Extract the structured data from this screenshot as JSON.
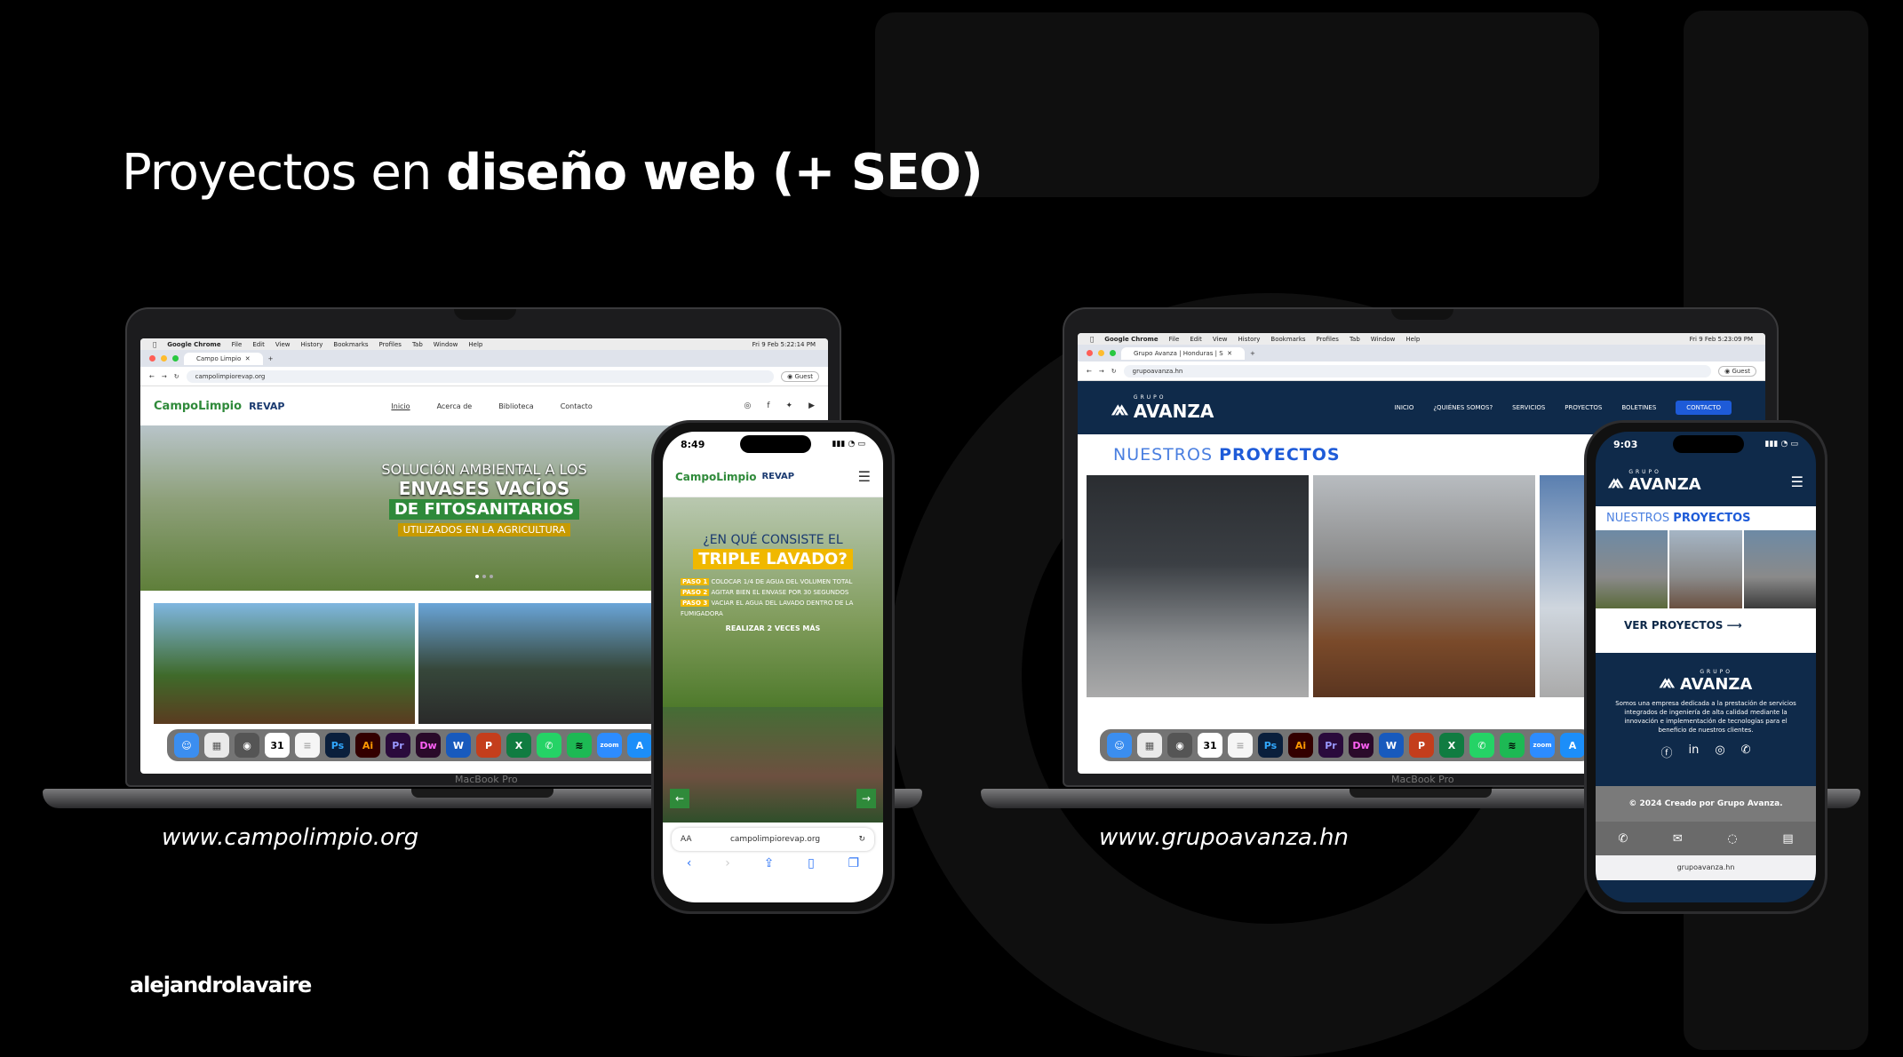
{
  "title": {
    "prefix": "Proyectos en ",
    "bold": "diseño web (+ SEO)"
  },
  "brand": "alejandrolavaire",
  "projects": [
    {
      "url_label": "www.campolimpio.org",
      "laptop_label": "MacBook Pro",
      "menubar": {
        "app": "Google Chrome",
        "menus": [
          "File",
          "Edit",
          "View",
          "History",
          "Bookmarks",
          "Profiles",
          "Tab",
          "Window",
          "Help"
        ],
        "clock": "Fri 9 Feb  5:22:14 PM"
      },
      "tab_title": "Campo Limpio",
      "address": "campolimpiorevap.org",
      "guest": "Guest",
      "logo": "CampoLimpio",
      "logo2": "REVAP",
      "nav": [
        "Inicio",
        "Acerca de",
        "Biblioteca",
        "Contacto"
      ],
      "hero": {
        "line1": "SOLUCIÓN AMBIENTAL A LOS",
        "line2": "ENVASES VACÍOS",
        "line3": "DE FITOSANITARIOS",
        "line4": "UTILIZADOS EN LA AGRICULTURA"
      },
      "phone": {
        "time": "8:49",
        "heading1": "¿EN QUÉ CONSISTE EL",
        "heading2": "TRIPLE LAVADO?",
        "steps": [
          {
            "tag": "PASO 1",
            "text": "COLOCAR 1/4 DE AGUA DEL VOLUMEN TOTAL"
          },
          {
            "tag": "PASO 2",
            "text": "AGITAR BIEN EL ENVASE  POR 30 SEGUNDOS"
          },
          {
            "tag": "PASO 3",
            "text": "VACIAR EL AGUA DEL LAVADO DENTRO DE LA FUMIGADORA"
          }
        ],
        "cta": "REALIZAR 2 VECES MÁS",
        "address_aa": "AA",
        "address": "campolimpiorevap.org"
      }
    },
    {
      "url_label": "www.grupoavanza.hn",
      "laptop_label": "MacBook Pro",
      "menubar": {
        "app": "Google Chrome",
        "menus": [
          "File",
          "Edit",
          "View",
          "History",
          "Bookmarks",
          "Profiles",
          "Tab",
          "Window",
          "Help"
        ],
        "clock": "Fri 9 Feb  5:23:09 PM"
      },
      "tab_title": "Grupo Avanza | Honduras | S",
      "address": "grupoavanza.hn",
      "guest": "Guest",
      "logo_small": "GRUPO",
      "logo": "AVANZA",
      "nav": [
        "INICIO",
        "¿QUIÉNES SOMOS?",
        "SERVICIOS",
        "PROYECTOS",
        "BOLETINES",
        "CONTACTO"
      ],
      "section_title_a": "NUESTROS ",
      "section_title_b": "PROYECTOS",
      "phone": {
        "time": "9:03",
        "section_title_a": "NUESTROS ",
        "section_title_b": "PROYECTOS",
        "cta": "VER PROYECTOS",
        "logo_small": "GRUPO",
        "logo": "AVANZA",
        "description": "Somos una empresa dedicada a la prestación de servicios integrados de ingeniería de alta calidad mediante la innovación e implementación de tecnologías para el beneficio de nuestros clientes.",
        "copyright": "© 2024 Creado por Grupo Avanza.",
        "address": "grupoavanza.hn"
      }
    }
  ],
  "dock_icons": [
    "finder-icon",
    "launchpad-icon",
    "chrome-icon",
    "calendar-icon",
    "notes-icon",
    "photoshop-icon",
    "illustrator-icon",
    "premiere-icon",
    "dreamweaver-icon",
    "word-icon",
    "powerpoint-icon",
    "excel-icon",
    "whatsapp-icon",
    "spotify-icon",
    "zoom-icon",
    "appstore-icon"
  ],
  "dock_labels": {
    "calendar": "31",
    "photoshop": "Ps",
    "illustrator": "Ai",
    "premiere": "Pr",
    "dreamweaver": "Dw",
    "word": "W",
    "powerpoint": "P",
    "excel": "X",
    "zoom": "zoom"
  },
  "colors": {
    "background": "#000000",
    "avanza_navy": "#0f2a4a",
    "avanza_blue": "#1e5bd8",
    "campo_green": "#2f8a3a",
    "campo_yellow": "#f0b800"
  }
}
